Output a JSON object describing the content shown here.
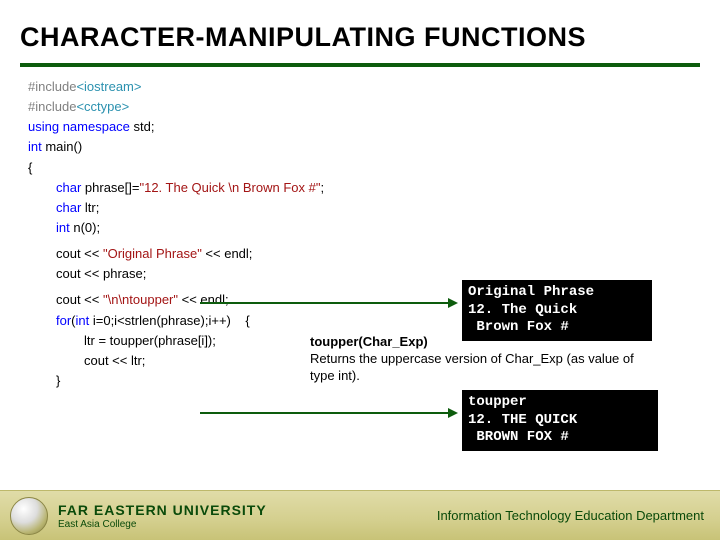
{
  "title": "CHARACTER-MANIPULATING FUNCTIONS",
  "code": {
    "l1a": "#include",
    "l1b": "<iostream>",
    "l2a": "#include",
    "l2b": "<cctype>",
    "l3a": "using",
    "l3b": " namespace",
    "l3c": " std;",
    "l4a": "int",
    "l4b": " main()",
    "l5": "{",
    "l6a": "char",
    "l6b": " phrase[]=",
    "l6c": "\"12. The Quick \\n Brown Fox #\"",
    "l6d": ";",
    "l7a": "char",
    "l7b": " ltr;",
    "l8a": "int",
    "l8b": " n(0);",
    "l9a": "cout << ",
    "l9b": "\"Original Phrase\"",
    "l9c": " << endl;",
    "l10a": "cout << phrase;",
    "l11a": "cout << ",
    "l11b": "\"\\n\\ntoupper\"",
    "l11c": " << endl;",
    "l12a": "for",
    "l12b": "(",
    "l12c": "int",
    "l12d": " i=0;i<strlen(phrase);i++)    {",
    "l13": "ltr = toupper(phrase[i]);",
    "l14": "cout << ltr;",
    "l15": "}"
  },
  "output1": "Original Phrase\n12. The Quick\n Brown Fox #",
  "output2": "toupper\n12. THE QUICK\n BROWN FOX #",
  "annotation": {
    "fn": "toupper(Char_Exp)",
    "desc": "Returns the uppercase version of Char_Exp (as value of type int)."
  },
  "footer": {
    "uni": "FAR EASTERN UNIVERSITY",
    "sub": "East Asia College",
    "dept": "Information Technology Education Department"
  }
}
